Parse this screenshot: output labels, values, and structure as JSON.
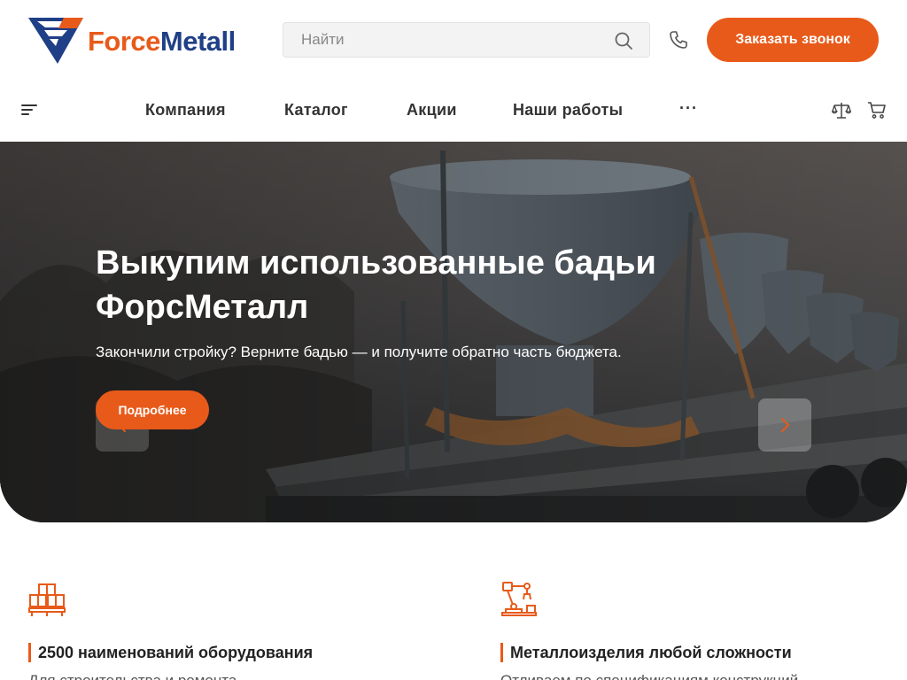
{
  "header": {
    "logo": {
      "part1": "Force",
      "part2": "Metall"
    },
    "search": {
      "placeholder": "Найти"
    },
    "callback_label": "Заказать звонок"
  },
  "nav": {
    "items": [
      {
        "label": "Компания"
      },
      {
        "label": "Каталог"
      },
      {
        "label": "Акции"
      },
      {
        "label": "Наши работы"
      }
    ],
    "more": "···"
  },
  "hero": {
    "title": "Выкупим использованные бадьи ФорсМеталл",
    "subtitle": "Закончили стройку? Верните бадью — и получите обратно часть бюджета.",
    "button_label": "Подробнее"
  },
  "features": [
    {
      "icon": "pallet-boxes-icon",
      "title": "2500 наименований оборудования",
      "description": "Для строительства и ремонта"
    },
    {
      "icon": "robot-arm-icon",
      "title": "Металлоизделия любой сложности",
      "description": "Отливаем по спецификациям конструкций"
    }
  ],
  "colors": {
    "accent": "#e85a1a",
    "brand_blue": "#1f3f86"
  }
}
